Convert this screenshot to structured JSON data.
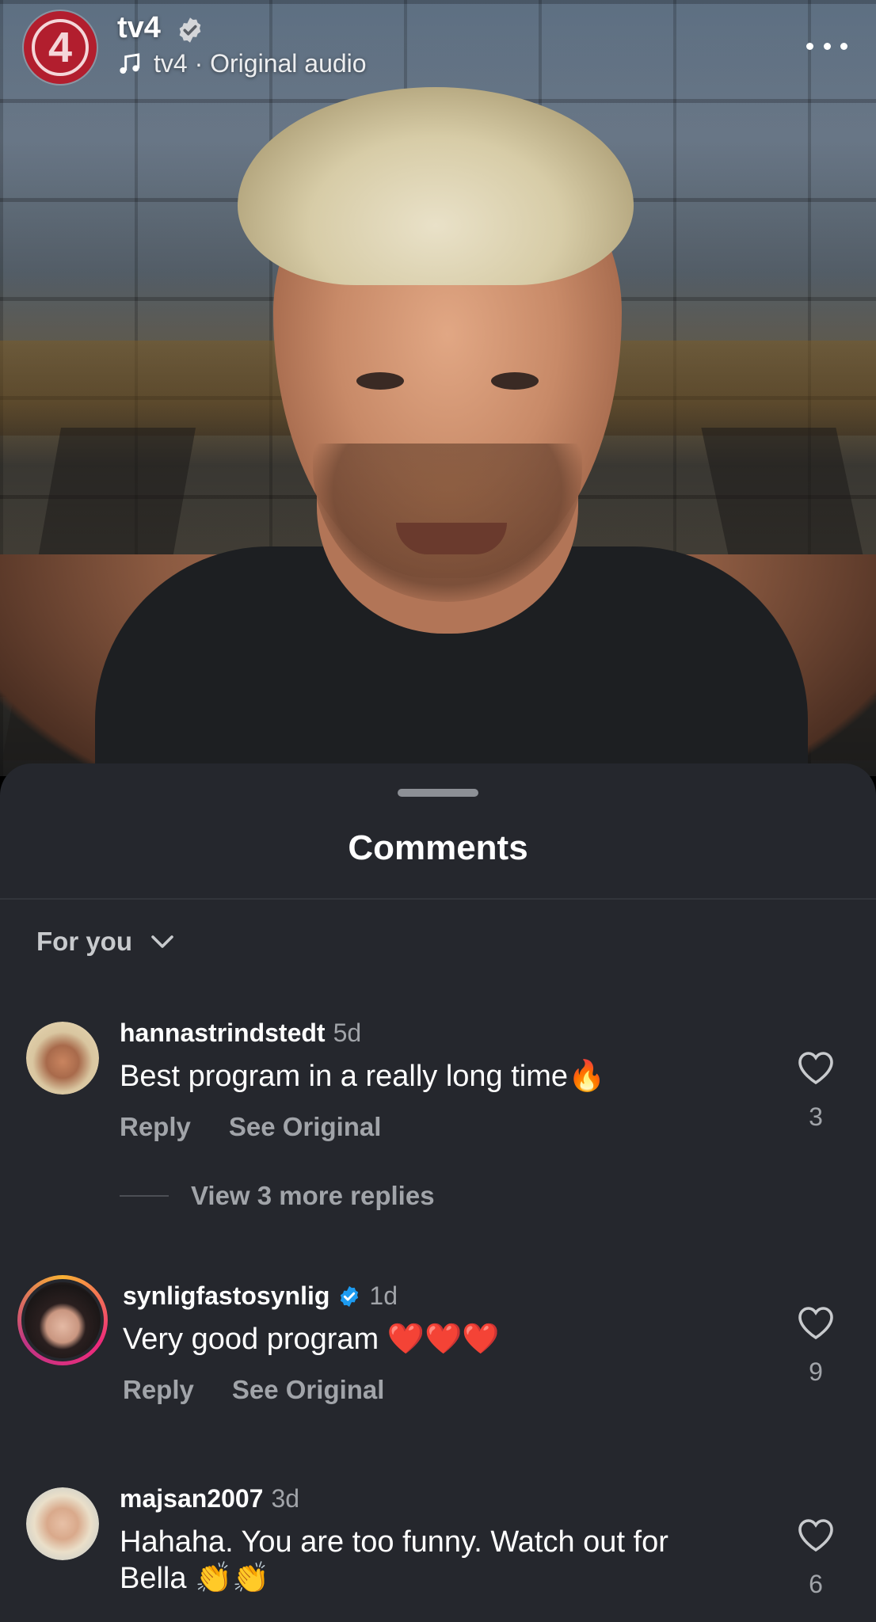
{
  "header": {
    "avatar_text": "4",
    "username": "tv4",
    "audio_label": "tv4 · Original audio"
  },
  "comments_sheet": {
    "title": "Comments",
    "filter_label": "For you",
    "comments": [
      {
        "username": "hannastrindstedt",
        "time": "5d",
        "text": "Best program in a really long time🔥",
        "reply_label": "Reply",
        "see_original_label": "See Original",
        "likes": "3",
        "view_replies_label": "View 3 more replies"
      },
      {
        "username": "synligfastosynlig",
        "time": "1d",
        "text": "Very good program ❤️❤️❤️",
        "reply_label": "Reply",
        "see_original_label": "See Original",
        "likes": "9"
      },
      {
        "username": "majsan2007",
        "time": "3d",
        "text": "Hahaha. You are too funny. Watch out for Bella 👏👏",
        "likes": "6"
      }
    ]
  },
  "colors": {
    "sheet_bg": "#25272d",
    "brand_red": "#b21e2e",
    "verified_blue": "#1d9bf0",
    "secondary_text": "#a1a4a9"
  }
}
